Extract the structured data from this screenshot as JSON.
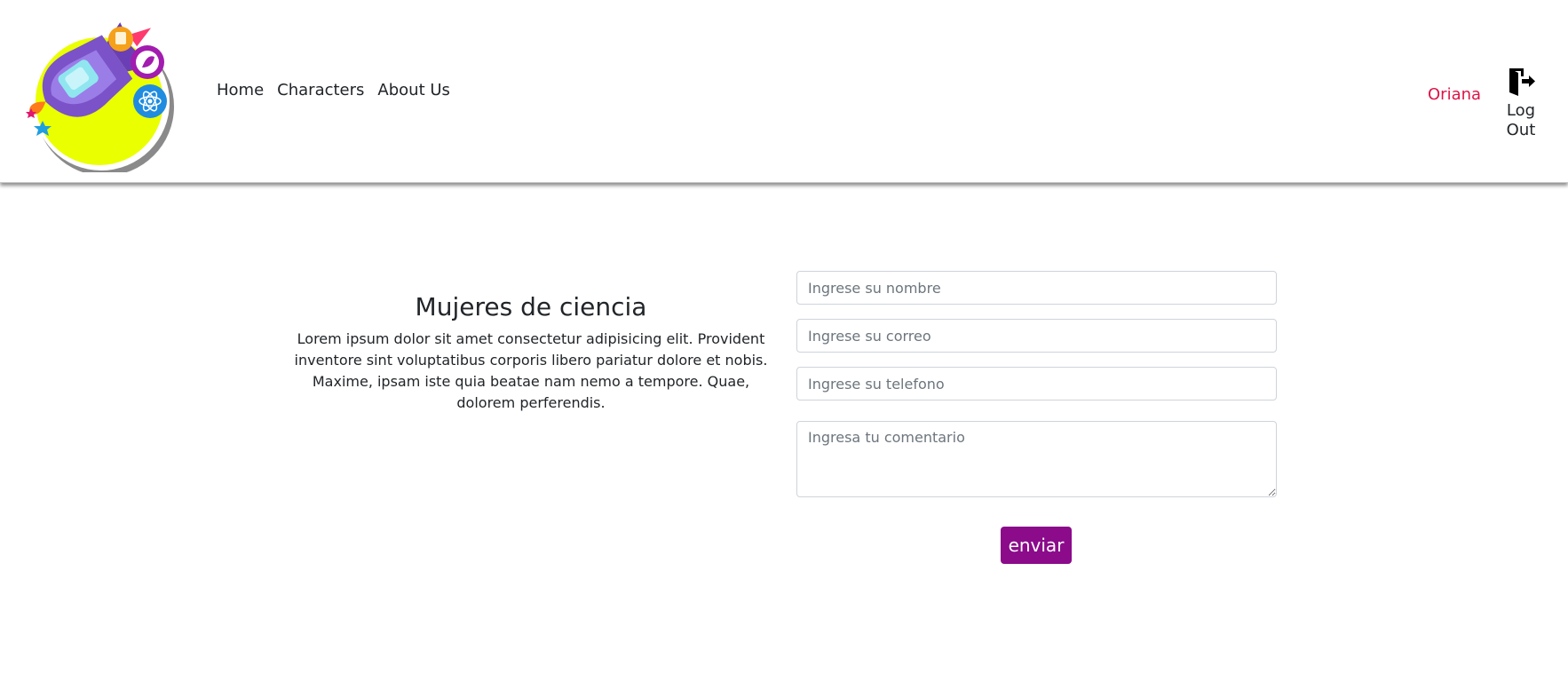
{
  "nav": {
    "links": [
      {
        "label": "Home"
      },
      {
        "label": "Characters"
      },
      {
        "label": "About Us"
      }
    ],
    "user_name": "Oriana",
    "logout_label": "Log Out"
  },
  "main": {
    "title": "Mujeres de ciencia",
    "description": "Lorem ipsum dolor sit amet consectetur adipisicing elit. Provident inventore sint voluptatibus corporis libero pariatur dolore et nobis. Maxime, ipsam iste quia beatae nam nemo a tempore. Quae, dolorem perferendis."
  },
  "form": {
    "name_placeholder": "Ingrese su nombre",
    "email_placeholder": "Ingrese su correo",
    "phone_placeholder": "Ingrese su telefono",
    "comment_placeholder": "Ingresa tu comentario",
    "submit_label": "enviar"
  },
  "colors": {
    "accent": "#8b0b8b",
    "user_name": "#dc1446",
    "logo_background": "#eaff00"
  },
  "icons": {
    "logo": "rocket-logo",
    "logout": "logout-door-icon"
  }
}
